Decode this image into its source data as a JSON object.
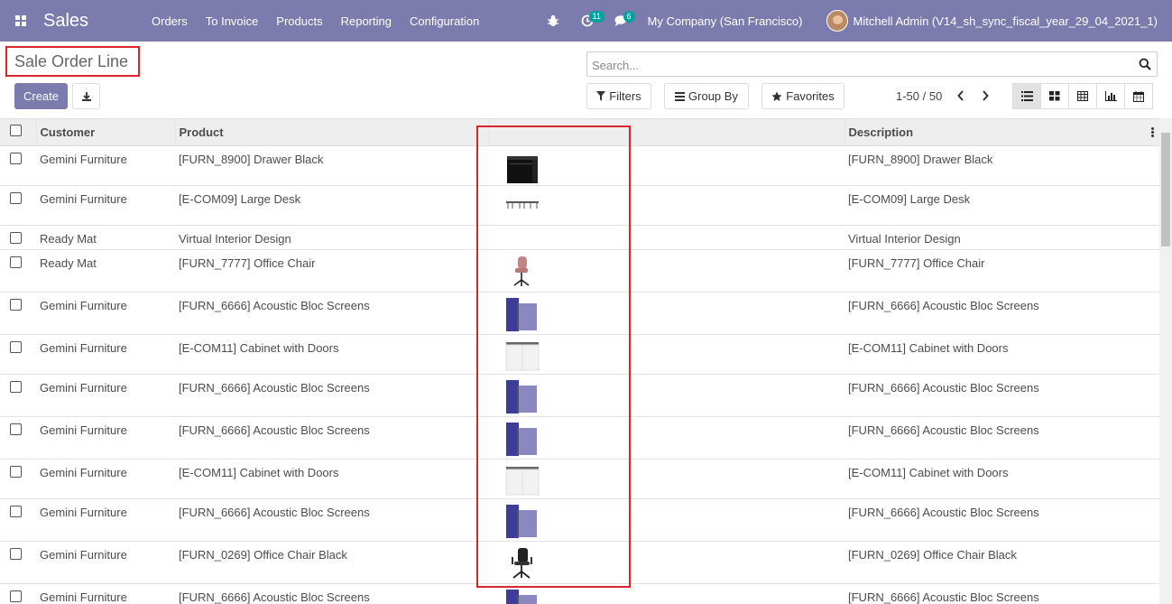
{
  "navbar": {
    "app_title": "Sales",
    "menu": [
      "Orders",
      "To Invoice",
      "Products",
      "Reporting",
      "Configuration"
    ],
    "activity_count": "11",
    "messages_count": "6",
    "company": "My Company (San Francisco)",
    "user": "Mitchell Admin (V14_sh_sync_fiscal_year_29_04_2021_1)"
  },
  "page": {
    "title": "Sale Order Line",
    "create_label": "Create",
    "search_placeholder": "Search...",
    "filters_label": "Filters",
    "groupby_label": "Group By",
    "favorites_label": "Favorites",
    "pager": "1-50 / 50"
  },
  "table": {
    "headers": {
      "customer": "Customer",
      "product": "Product",
      "image": "",
      "description": "Description"
    },
    "rows": [
      {
        "customer": "Gemini Furniture",
        "product": "[FURN_8900] Drawer Black",
        "image": "drawer-black",
        "description": "[FURN_8900] Drawer Black"
      },
      {
        "customer": "Gemini Furniture",
        "product": "[E-COM09] Large Desk",
        "image": "large-desk",
        "description": "[E-COM09] Large Desk"
      },
      {
        "customer": "Ready Mat",
        "product": "Virtual Interior Design",
        "image": "",
        "description": "Virtual Interior Design"
      },
      {
        "customer": "Ready Mat",
        "product": "[FURN_7777] Office Chair",
        "image": "office-chair-pink",
        "description": "[FURN_7777] Office Chair"
      },
      {
        "customer": "Gemini Furniture",
        "product": "[FURN_6666] Acoustic Bloc Screens",
        "image": "acoustic-screens",
        "description": "[FURN_6666] Acoustic Bloc Screens"
      },
      {
        "customer": "Gemini Furniture",
        "product": "[E-COM11] Cabinet with Doors",
        "image": "cabinet-doors",
        "description": "[E-COM11] Cabinet with Doors"
      },
      {
        "customer": "Gemini Furniture",
        "product": "[FURN_6666] Acoustic Bloc Screens",
        "image": "acoustic-screens",
        "description": "[FURN_6666] Acoustic Bloc Screens"
      },
      {
        "customer": "Gemini Furniture",
        "product": "[FURN_6666] Acoustic Bloc Screens",
        "image": "acoustic-screens",
        "description": "[FURN_6666] Acoustic Bloc Screens"
      },
      {
        "customer": "Gemini Furniture",
        "product": "[E-COM11] Cabinet with Doors",
        "image": "cabinet-doors",
        "description": "[E-COM11] Cabinet with Doors"
      },
      {
        "customer": "Gemini Furniture",
        "product": "[FURN_6666] Acoustic Bloc Screens",
        "image": "acoustic-screens",
        "description": "[FURN_6666] Acoustic Bloc Screens"
      },
      {
        "customer": "Gemini Furniture",
        "product": "[FURN_0269] Office Chair Black",
        "image": "office-chair-black",
        "description": "[FURN_0269] Office Chair Black"
      },
      {
        "customer": "Gemini Furniture",
        "product": "[FURN_6666] Acoustic Bloc Screens",
        "image": "acoustic-screens",
        "description": "[FURN_6666] Acoustic Bloc Screens"
      }
    ]
  },
  "colors": {
    "brand": "#7c7bad",
    "highlight": "#d9262c",
    "badge": "#00a09d"
  }
}
